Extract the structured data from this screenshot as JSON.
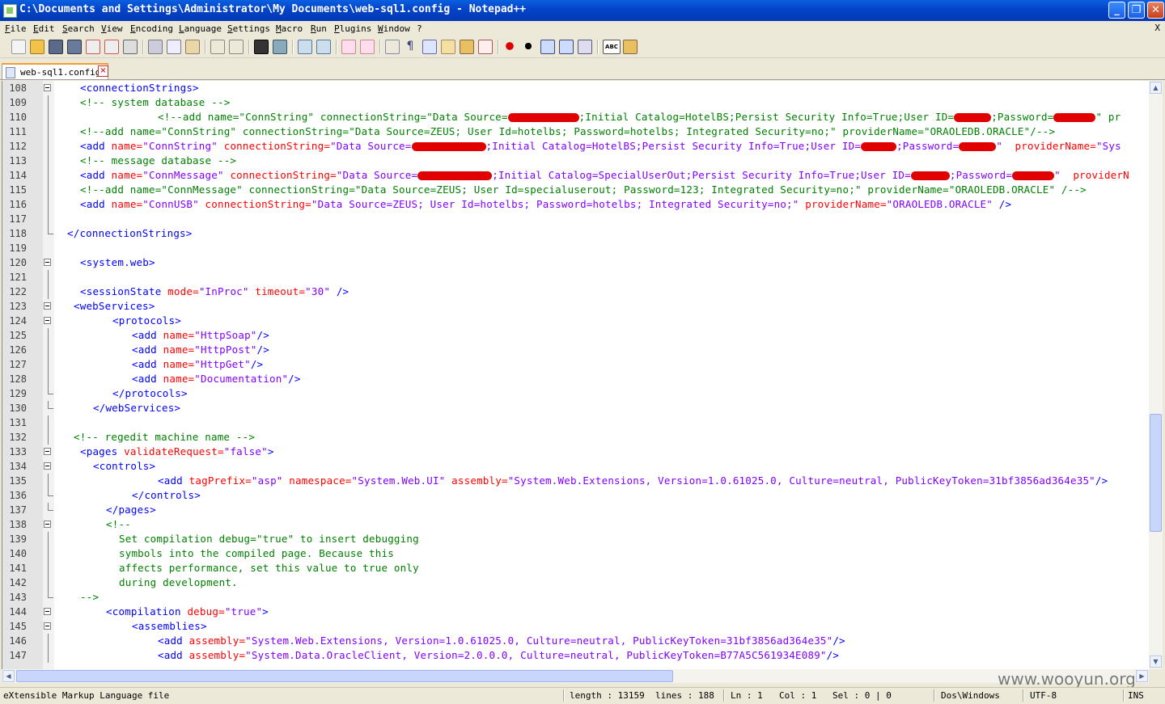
{
  "window": {
    "title": "C:\\Documents and Settings\\Administrator\\My Documents\\web-sql1.config - Notepad++"
  },
  "menu": [
    "File",
    "Edit",
    "Search",
    "View",
    "Encoding",
    "Language",
    "Settings",
    "Macro",
    "Run",
    "Plugins",
    "Window",
    "?"
  ],
  "menu_close": "X",
  "tab": {
    "label": "web-sql1.config"
  },
  "lines": [
    {
      "n": "108"
    },
    {
      "n": "109"
    },
    {
      "n": "110"
    },
    {
      "n": "111"
    },
    {
      "n": "112"
    },
    {
      "n": "113"
    },
    {
      "n": "114"
    },
    {
      "n": "115"
    },
    {
      "n": "116"
    },
    {
      "n": "117"
    },
    {
      "n": "118"
    },
    {
      "n": "119"
    },
    {
      "n": "120"
    },
    {
      "n": "121"
    },
    {
      "n": "122"
    },
    {
      "n": "123"
    },
    {
      "n": "124"
    },
    {
      "n": "125"
    },
    {
      "n": "126"
    },
    {
      "n": "127"
    },
    {
      "n": "128"
    },
    {
      "n": "129"
    },
    {
      "n": "130"
    },
    {
      "n": "131"
    },
    {
      "n": "132"
    },
    {
      "n": "133"
    },
    {
      "n": "134"
    },
    {
      "n": "135"
    },
    {
      "n": "136"
    },
    {
      "n": "137"
    },
    {
      "n": "138"
    },
    {
      "n": "139"
    },
    {
      "n": "140"
    },
    {
      "n": "141"
    },
    {
      "n": "142"
    },
    {
      "n": "143"
    },
    {
      "n": "144"
    },
    {
      "n": "145"
    },
    {
      "n": "146"
    },
    {
      "n": "147"
    }
  ],
  "code": {
    "l108": "<connectionStrings>",
    "l109": "<!-- system database -->",
    "l110a": "<!--add name=\"ConnString\" connectionString=\"Data Source=",
    "l110b": ";Initial Catalog=HotelBS;Persist Security Info=True;User ID=",
    "l110c": ";Password=",
    "l110d": "\" pr",
    "l111": "<!--add name=\"ConnString\" connectionString=\"Data Source=ZEUS; User Id=hotelbs; Password=hotelbs; Integrated Security=no;\" providerName=\"ORAOLEDB.ORACLE\"/-->",
    "l112a": "<add",
    "l112b": "name=",
    "l112c": "\"ConnString\"",
    "l112d": "connectionString=",
    "l112e": "\"Data Source=",
    "l112f": ";Initial Catalog=HotelBS;Persist Security Info=True;User ID=",
    "l112g": ";Password=",
    "l112h": "\"",
    "l112i": "providerName=",
    "l112j": "\"Sys",
    "l113": "<!-- message database -->",
    "l114a": "<add",
    "l114b": "name=",
    "l114c": "\"ConnMessage\"",
    "l114d": "connectionString=",
    "l114e": "\"Data Source=",
    "l114f": ";Initial Catalog=SpecialUserOut;Persist Security Info=True;User ID=",
    "l114g": ";Password=",
    "l114h": "\"",
    "l114i": "providerN",
    "l115": "<!--add name=\"ConnMessage\" connectionString=\"Data Source=ZEUS; User Id=specialuserout; Password=123; Integrated Security=no;\" providerName=\"ORAOLEDB.ORACLE\" /-->",
    "l116a": "<add",
    "l116b": "name=",
    "l116c": "\"ConnUSB\"",
    "l116d": "connectionString=",
    "l116e": "\"Data Source=ZEUS; User Id=hotelbs; Password=hotelbs; Integrated Security=no;\"",
    "l116f": "providerName=",
    "l116g": "\"ORAOLEDB.ORACLE\"",
    "l116h": "/>",
    "l118": "</connectionStrings>",
    "l120": "<system.web>",
    "l122a": "<sessionState",
    "l122b": "mode=",
    "l122c": "\"InProc\"",
    "l122d": "timeout=",
    "l122e": "\"30\"",
    "l122f": "/>",
    "l123": "<webServices>",
    "l124": "<protocols>",
    "l125a": "<add",
    "l125b": "name=",
    "l125c": "\"HttpSoap\"",
    "l125d": "/>",
    "l126a": "<add",
    "l126b": "name=",
    "l126c": "\"HttpPost\"",
    "l126d": "/>",
    "l127a": "<add",
    "l127b": "name=",
    "l127c": "\"HttpGet\"",
    "l127d": "/>",
    "l128a": "<add",
    "l128b": "name=",
    "l128c": "\"Documentation\"",
    "l128d": "/>",
    "l129": "</protocols>",
    "l130": "</webServices>",
    "l132": "<!-- regedit machine name -->",
    "l133a": "<pages",
    "l133b": "validateRequest=",
    "l133c": "\"false\"",
    "l133d": ">",
    "l134": "<controls>",
    "l135a": "<add",
    "l135b": "tagPrefix=",
    "l135c": "\"asp\"",
    "l135d": "namespace=",
    "l135e": "\"System.Web.UI\"",
    "l135f": "assembly=",
    "l135g": "\"System.Web.Extensions, Version=1.0.61025.0, Culture=neutral, PublicKeyToken=31bf3856ad364e35\"",
    "l135h": "/>",
    "l136": "</controls>",
    "l137": "</pages>",
    "l138": "<!--",
    "l139": "Set compilation debug=\"true\" to insert debugging",
    "l140": "symbols into the compiled page. Because this",
    "l141": "affects performance, set this value to true only",
    "l142": "during development.",
    "l143": "-->",
    "l144a": "<compilation",
    "l144b": "debug=",
    "l144c": "\"true\"",
    "l144d": ">",
    "l145": "<assemblies>",
    "l146a": "<add",
    "l146b": "assembly=",
    "l146c": "\"System.Web.Extensions, Version=1.0.61025.0, Culture=neutral, PublicKeyToken=31bf3856ad364e35\"",
    "l146d": "/>",
    "l147a": "<add",
    "l147b": "assembly=",
    "l147c": "\"System.Data.OracleClient, Version=2.0.0.0, Culture=neutral, PublicKeyToken=B77A5C561934E089\"",
    "l147d": "/>"
  },
  "status": {
    "filetype": "eXtensible Markup Language file",
    "length": "length : 13159",
    "lines": "lines : 188",
    "ln": "Ln : 1",
    "col": "Col : 1",
    "sel": "Sel : 0 | 0",
    "eol": "Dos\\Windows",
    "encoding": "UTF-8",
    "mode": "INS"
  },
  "watermark": "www.wooyun.org",
  "colors": {
    "tag": "#0000ff",
    "attr": "#ff0000",
    "value": "#8000ff",
    "comment": "#008000",
    "redaction": "#e00000"
  }
}
